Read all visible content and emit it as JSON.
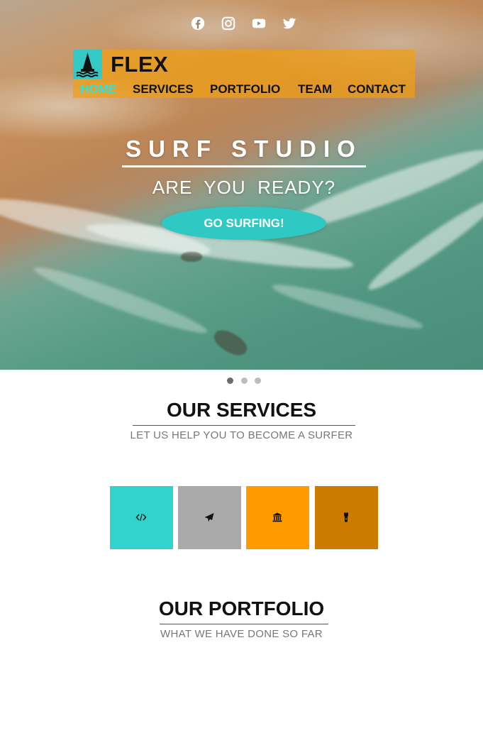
{
  "social": [
    {
      "icon": "facebook-icon"
    },
    {
      "icon": "instagram-icon"
    },
    {
      "icon": "youtube-icon"
    },
    {
      "icon": "twitter-icon"
    }
  ],
  "brand": {
    "logo_icon": "boat-icon",
    "name": "FLEX"
  },
  "nav": [
    {
      "label": "HOME",
      "active": true
    },
    {
      "label": "SERVICES"
    },
    {
      "label": "PORTFOLIO"
    },
    {
      "label": "TEAM"
    },
    {
      "label": "CONTACT"
    }
  ],
  "hero": {
    "title": "SURF STUDIO",
    "subtitle": "ARE  YOU  READY?",
    "cta_label": "GO SURFING!"
  },
  "slider": {
    "count": 3,
    "active_index": 0
  },
  "services": {
    "title": "OUR SERVICES",
    "subtitle": "LET US HELP YOU TO BECOME A SURFER",
    "tiles": [
      {
        "icon": "code-icon",
        "color": "#33d3cd"
      },
      {
        "icon": "paper-plane-icon",
        "color": "#aaaaaa"
      },
      {
        "icon": "bank-icon",
        "color": "#ff9b00"
      },
      {
        "icon": "flashlight-icon",
        "color": "#cc7a00"
      }
    ]
  },
  "portfolio": {
    "title": "OUR PORTFOLIO",
    "subtitle": "WHAT WE HAVE DONE SO FAR"
  },
  "colors": {
    "accent": "#33c9c6",
    "nav_bg": "#f0a014",
    "nav_active": "#33e0dc"
  }
}
